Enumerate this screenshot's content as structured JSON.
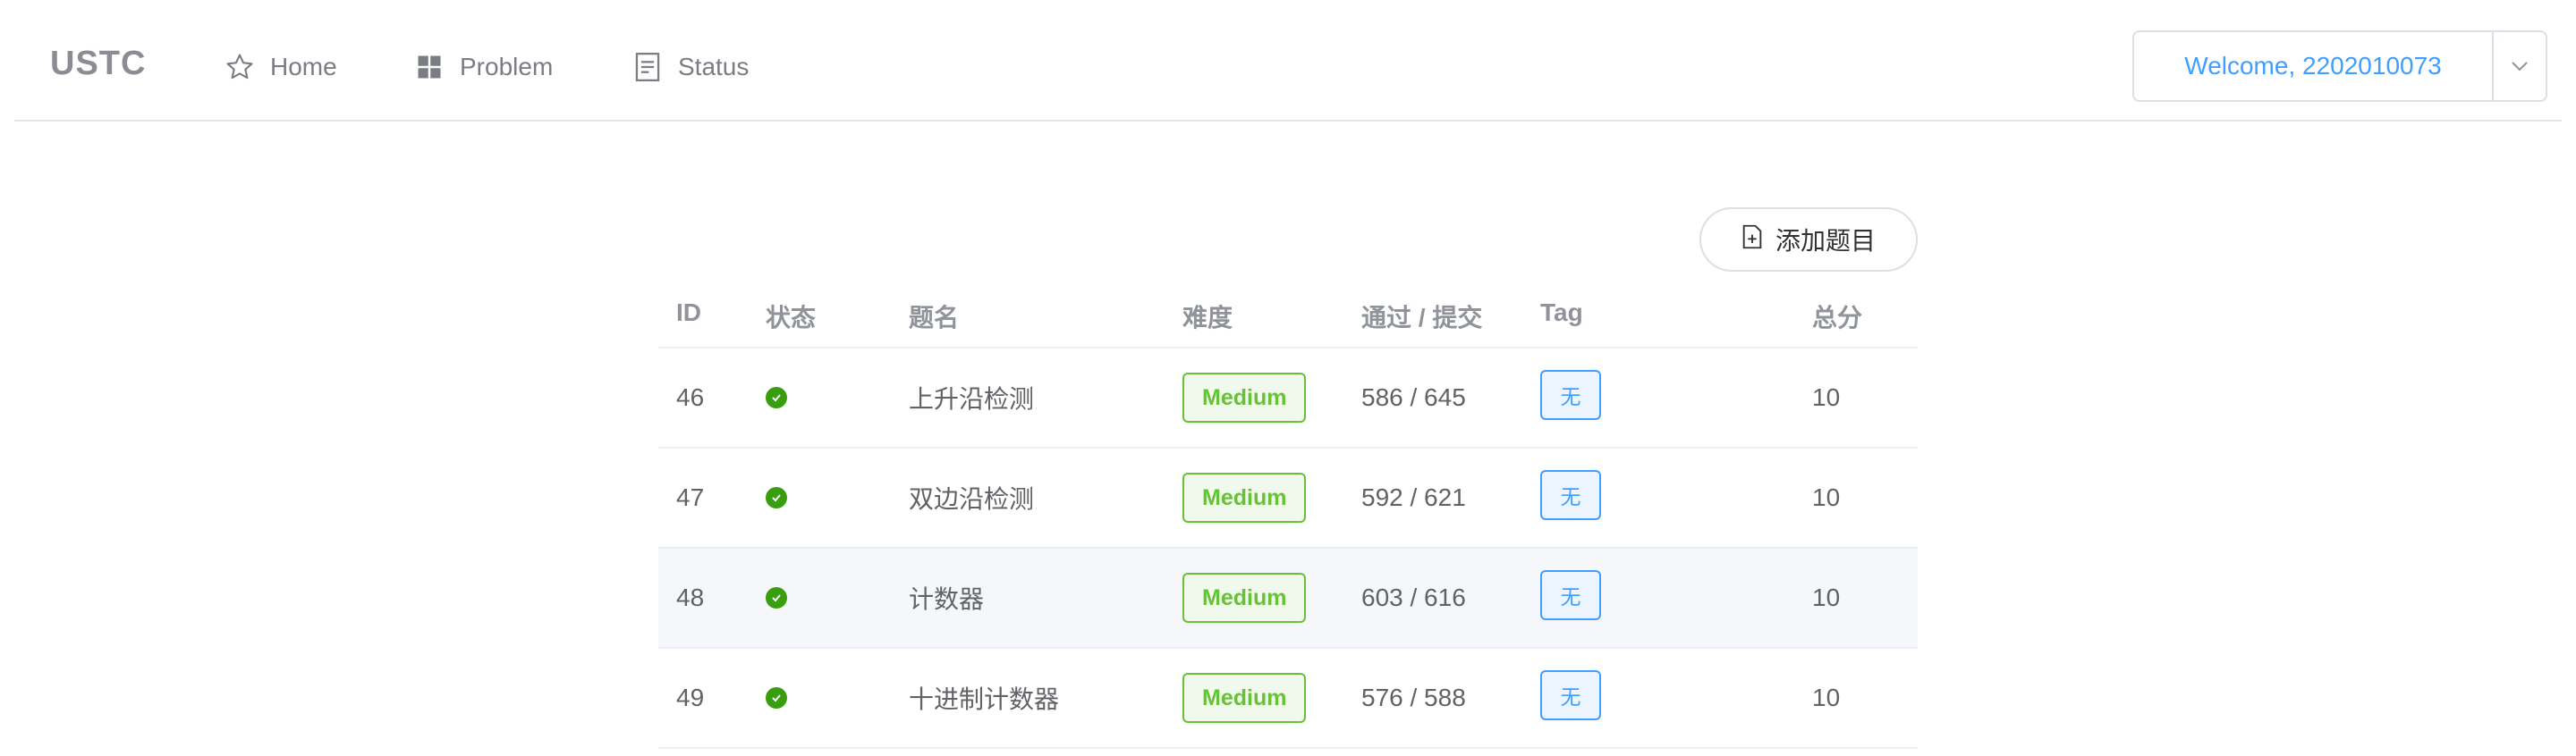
{
  "nav": {
    "brand": "USTC",
    "items": [
      {
        "label": "Home",
        "icon": "star-icon"
      },
      {
        "label": "Problem",
        "icon": "grid-icon"
      },
      {
        "label": "Status",
        "icon": "document-icon"
      }
    ],
    "user_label": "Welcome, 2202010073"
  },
  "toolbar": {
    "add_label": "添加题目"
  },
  "table": {
    "headers": [
      "ID",
      "状态",
      "题名",
      "难度",
      "通过 / 提交",
      "Tag",
      "总分"
    ],
    "rows": [
      {
        "id": "46",
        "title": "上升沿检测",
        "difficulty": "Medium",
        "ratio": "586 / 645",
        "tag": "无",
        "score": "10",
        "solved": true
      },
      {
        "id": "47",
        "title": "双边沿检测",
        "difficulty": "Medium",
        "ratio": "592 / 621",
        "tag": "无",
        "score": "10",
        "solved": true
      },
      {
        "id": "48",
        "title": "计数器",
        "difficulty": "Medium",
        "ratio": "603 / 616",
        "tag": "无",
        "score": "10",
        "solved": true
      },
      {
        "id": "49",
        "title": "十进制计数器",
        "difficulty": "Medium",
        "ratio": "576 / 588",
        "tag": "无",
        "score": "10",
        "solved": true
      }
    ]
  },
  "colors": {
    "accent": "#409eff",
    "success": "#67c23a",
    "status_solved": "#389e0d"
  }
}
